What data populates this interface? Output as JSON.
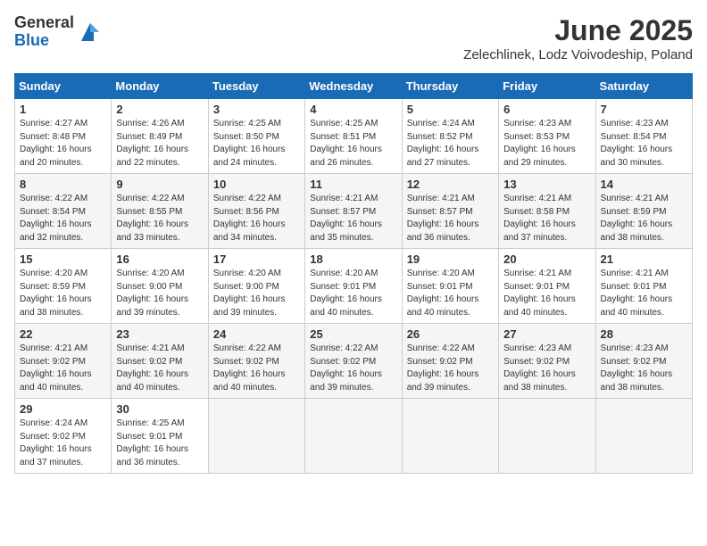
{
  "logo": {
    "general": "General",
    "blue": "Blue"
  },
  "title": "June 2025",
  "subtitle": "Zelechlinek, Lodz Voivodeship, Poland",
  "headers": [
    "Sunday",
    "Monday",
    "Tuesday",
    "Wednesday",
    "Thursday",
    "Friday",
    "Saturday"
  ],
  "weeks": [
    [
      {
        "day": "1",
        "info": "Sunrise: 4:27 AM\nSunset: 8:48 PM\nDaylight: 16 hours\nand 20 minutes."
      },
      {
        "day": "2",
        "info": "Sunrise: 4:26 AM\nSunset: 8:49 PM\nDaylight: 16 hours\nand 22 minutes."
      },
      {
        "day": "3",
        "info": "Sunrise: 4:25 AM\nSunset: 8:50 PM\nDaylight: 16 hours\nand 24 minutes."
      },
      {
        "day": "4",
        "info": "Sunrise: 4:25 AM\nSunset: 8:51 PM\nDaylight: 16 hours\nand 26 minutes."
      },
      {
        "day": "5",
        "info": "Sunrise: 4:24 AM\nSunset: 8:52 PM\nDaylight: 16 hours\nand 27 minutes."
      },
      {
        "day": "6",
        "info": "Sunrise: 4:23 AM\nSunset: 8:53 PM\nDaylight: 16 hours\nand 29 minutes."
      },
      {
        "day": "7",
        "info": "Sunrise: 4:23 AM\nSunset: 8:54 PM\nDaylight: 16 hours\nand 30 minutes."
      }
    ],
    [
      {
        "day": "8",
        "info": "Sunrise: 4:22 AM\nSunset: 8:54 PM\nDaylight: 16 hours\nand 32 minutes."
      },
      {
        "day": "9",
        "info": "Sunrise: 4:22 AM\nSunset: 8:55 PM\nDaylight: 16 hours\nand 33 minutes."
      },
      {
        "day": "10",
        "info": "Sunrise: 4:22 AM\nSunset: 8:56 PM\nDaylight: 16 hours\nand 34 minutes."
      },
      {
        "day": "11",
        "info": "Sunrise: 4:21 AM\nSunset: 8:57 PM\nDaylight: 16 hours\nand 35 minutes."
      },
      {
        "day": "12",
        "info": "Sunrise: 4:21 AM\nSunset: 8:57 PM\nDaylight: 16 hours\nand 36 minutes."
      },
      {
        "day": "13",
        "info": "Sunrise: 4:21 AM\nSunset: 8:58 PM\nDaylight: 16 hours\nand 37 minutes."
      },
      {
        "day": "14",
        "info": "Sunrise: 4:21 AM\nSunset: 8:59 PM\nDaylight: 16 hours\nand 38 minutes."
      }
    ],
    [
      {
        "day": "15",
        "info": "Sunrise: 4:20 AM\nSunset: 8:59 PM\nDaylight: 16 hours\nand 38 minutes."
      },
      {
        "day": "16",
        "info": "Sunrise: 4:20 AM\nSunset: 9:00 PM\nDaylight: 16 hours\nand 39 minutes."
      },
      {
        "day": "17",
        "info": "Sunrise: 4:20 AM\nSunset: 9:00 PM\nDaylight: 16 hours\nand 39 minutes."
      },
      {
        "day": "18",
        "info": "Sunrise: 4:20 AM\nSunset: 9:01 PM\nDaylight: 16 hours\nand 40 minutes."
      },
      {
        "day": "19",
        "info": "Sunrise: 4:20 AM\nSunset: 9:01 PM\nDaylight: 16 hours\nand 40 minutes."
      },
      {
        "day": "20",
        "info": "Sunrise: 4:21 AM\nSunset: 9:01 PM\nDaylight: 16 hours\nand 40 minutes."
      },
      {
        "day": "21",
        "info": "Sunrise: 4:21 AM\nSunset: 9:01 PM\nDaylight: 16 hours\nand 40 minutes."
      }
    ],
    [
      {
        "day": "22",
        "info": "Sunrise: 4:21 AM\nSunset: 9:02 PM\nDaylight: 16 hours\nand 40 minutes."
      },
      {
        "day": "23",
        "info": "Sunrise: 4:21 AM\nSunset: 9:02 PM\nDaylight: 16 hours\nand 40 minutes."
      },
      {
        "day": "24",
        "info": "Sunrise: 4:22 AM\nSunset: 9:02 PM\nDaylight: 16 hours\nand 40 minutes."
      },
      {
        "day": "25",
        "info": "Sunrise: 4:22 AM\nSunset: 9:02 PM\nDaylight: 16 hours\nand 39 minutes."
      },
      {
        "day": "26",
        "info": "Sunrise: 4:22 AM\nSunset: 9:02 PM\nDaylight: 16 hours\nand 39 minutes."
      },
      {
        "day": "27",
        "info": "Sunrise: 4:23 AM\nSunset: 9:02 PM\nDaylight: 16 hours\nand 38 minutes."
      },
      {
        "day": "28",
        "info": "Sunrise: 4:23 AM\nSunset: 9:02 PM\nDaylight: 16 hours\nand 38 minutes."
      }
    ],
    [
      {
        "day": "29",
        "info": "Sunrise: 4:24 AM\nSunset: 9:02 PM\nDaylight: 16 hours\nand 37 minutes."
      },
      {
        "day": "30",
        "info": "Sunrise: 4:25 AM\nSunset: 9:01 PM\nDaylight: 16 hours\nand 36 minutes."
      },
      null,
      null,
      null,
      null,
      null
    ]
  ]
}
